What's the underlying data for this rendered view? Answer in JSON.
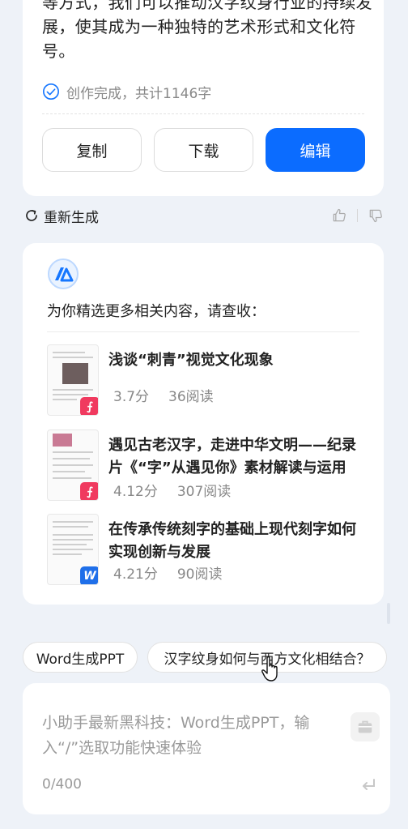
{
  "answer": {
    "text": "等方式，我们可以推动汉字纹身行业的持续发展，使其成为一种独特的艺术形式和文化符号。",
    "status": "创作完成，共计1146字",
    "buttons": {
      "copy": "复制",
      "download": "下载",
      "edit": "编辑"
    },
    "accent_color": "#0b6cff"
  },
  "actions": {
    "regenerate": "重新生成"
  },
  "recommend": {
    "heading": "为你精选更多相关内容，请查收：",
    "items": [
      {
        "title": "浅谈“刺青”视觉文化现象",
        "score": "3.7分",
        "reads": "36阅读",
        "type": "pdf"
      },
      {
        "title": "遇见古老汉字，走进中华文明——纪录片《“字”从遇见你》素材解读与运用",
        "score": "4.12分",
        "reads": "307阅读",
        "type": "pdf"
      },
      {
        "title": "在传承传统刻字的基础上现代刻字如何实现创新与发展",
        "score": "4.21分",
        "reads": "90阅读",
        "type": "word"
      }
    ]
  },
  "suggestions": [
    "Word生成PPT",
    "汉字纹身如何与西方文化相结合？"
  ],
  "input": {
    "placeholder": "小助手最新黑科技：Word生成PPT，输入“/”选取功能快速体验",
    "counter": "0/400"
  },
  "icons": {
    "check": "check-circle-icon",
    "regenerate": "refresh-icon",
    "like": "thumbs-up-icon",
    "dislike": "thumbs-down-icon",
    "pdf": "pdf-icon",
    "word": "word-icon",
    "tool": "briefcase-icon",
    "send": "enter-icon"
  }
}
